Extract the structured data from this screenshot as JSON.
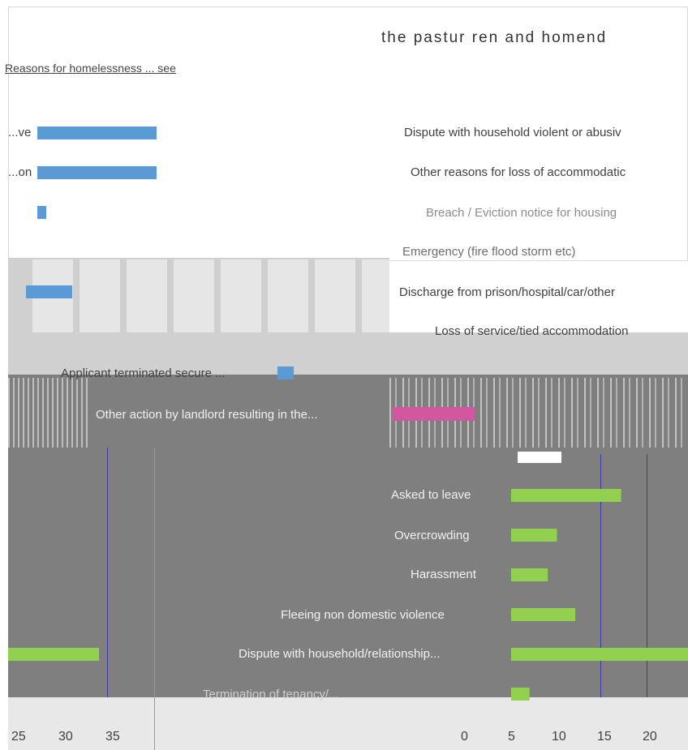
{
  "window": {
    "title_fragment": "the pastur ren and homend",
    "subtitle_fragment": "Reasons for homelessness ... see"
  },
  "colors": {
    "blue_series": "#5b9bd5",
    "pink_series": "#d1579f",
    "green_series": "#92d050",
    "panel_gray": "#7f7f7f",
    "panel_light": "#d0d0d0"
  },
  "chart_data": [
    {
      "type": "bar",
      "orientation": "horizontal",
      "panel": "top-left",
      "categories": [
        "...ve",
        "...on",
        "...",
        "..."
      ],
      "values": [
        13,
        13,
        1,
        5
      ],
      "color": "#5b9bd5",
      "x_ticks": [
        "25",
        "30",
        "35"
      ]
    },
    {
      "type": "bar",
      "orientation": "horizontal",
      "panel": "top-right",
      "categories": [
        "Dispute with household violent or abusiv",
        "Other reasons for loss of accommodatic",
        "Breach / Eviction notice for housing",
        "Emergency (fire flood storm etc)",
        "Discharge from prison/hospital/car/other",
        "Loss of service/tied accommodation"
      ],
      "values": [
        null,
        null,
        null,
        null,
        null,
        null
      ]
    },
    {
      "type": "bar",
      "orientation": "horizontal",
      "panel": "middle",
      "categories": [
        "Applicant terminated secure ...",
        "Other action by landlord resulting in the..."
      ],
      "values": [
        1.5,
        9
      ],
      "colors": [
        "#5b9bd5",
        "#d1579f"
      ]
    },
    {
      "type": "bar",
      "orientation": "horizontal",
      "panel": "bottom-right",
      "categories": [
        "Asked to leave",
        "Overcrowding",
        "Harassment",
        "Fleeing non domestic violence",
        "Dispute with household/relationship...",
        "Termination of tenancy/..."
      ],
      "values": [
        12,
        5,
        4,
        7,
        22,
        2
      ],
      "color": "#92d050",
      "x_ticks": [
        "0",
        "5",
        "10",
        "15",
        "20"
      ],
      "xlim": [
        0,
        22
      ]
    }
  ]
}
